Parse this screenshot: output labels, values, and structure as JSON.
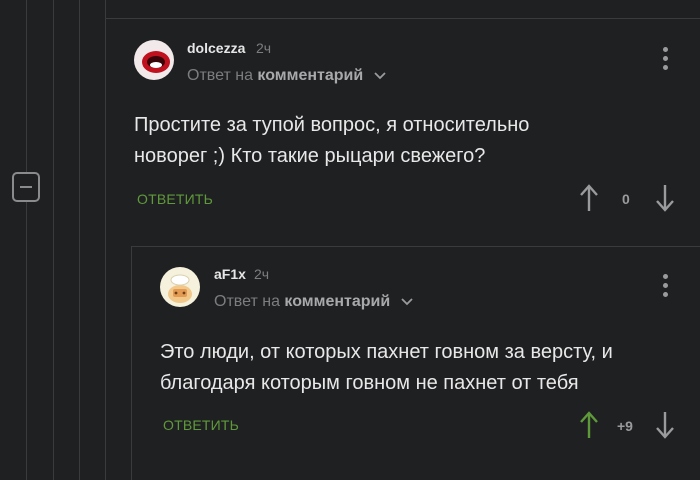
{
  "comments": [
    {
      "username": "dolcezza",
      "time": "2ч",
      "reply_prefix": "Ответ на",
      "reply_target": "комментарий",
      "body_lines": [
        "Простите за тупой вопрос, я относительно",
        "новорег ;) Кто такие рыцари свежего?"
      ],
      "reply_label": "ОТВЕТИТЬ",
      "score": "0",
      "avatar_icon": "red-lips-avatar-icon"
    },
    {
      "username": "aF1x",
      "time": "2ч",
      "reply_prefix": "Ответ на",
      "reply_target": "комментарий",
      "body_lines": [
        "Это люди, от которых пахнет говном за версту, и",
        "благодаря которым говном не пахнет от тебя"
      ],
      "reply_label": "ОТВЕТИТЬ",
      "score": "+9",
      "upvoted": true,
      "avatar_icon": "cartoon-avatar-icon"
    }
  ],
  "colors": {
    "background": "#1f2022",
    "accent_green": "#5f9a3a",
    "muted": "#7c7d7f"
  }
}
